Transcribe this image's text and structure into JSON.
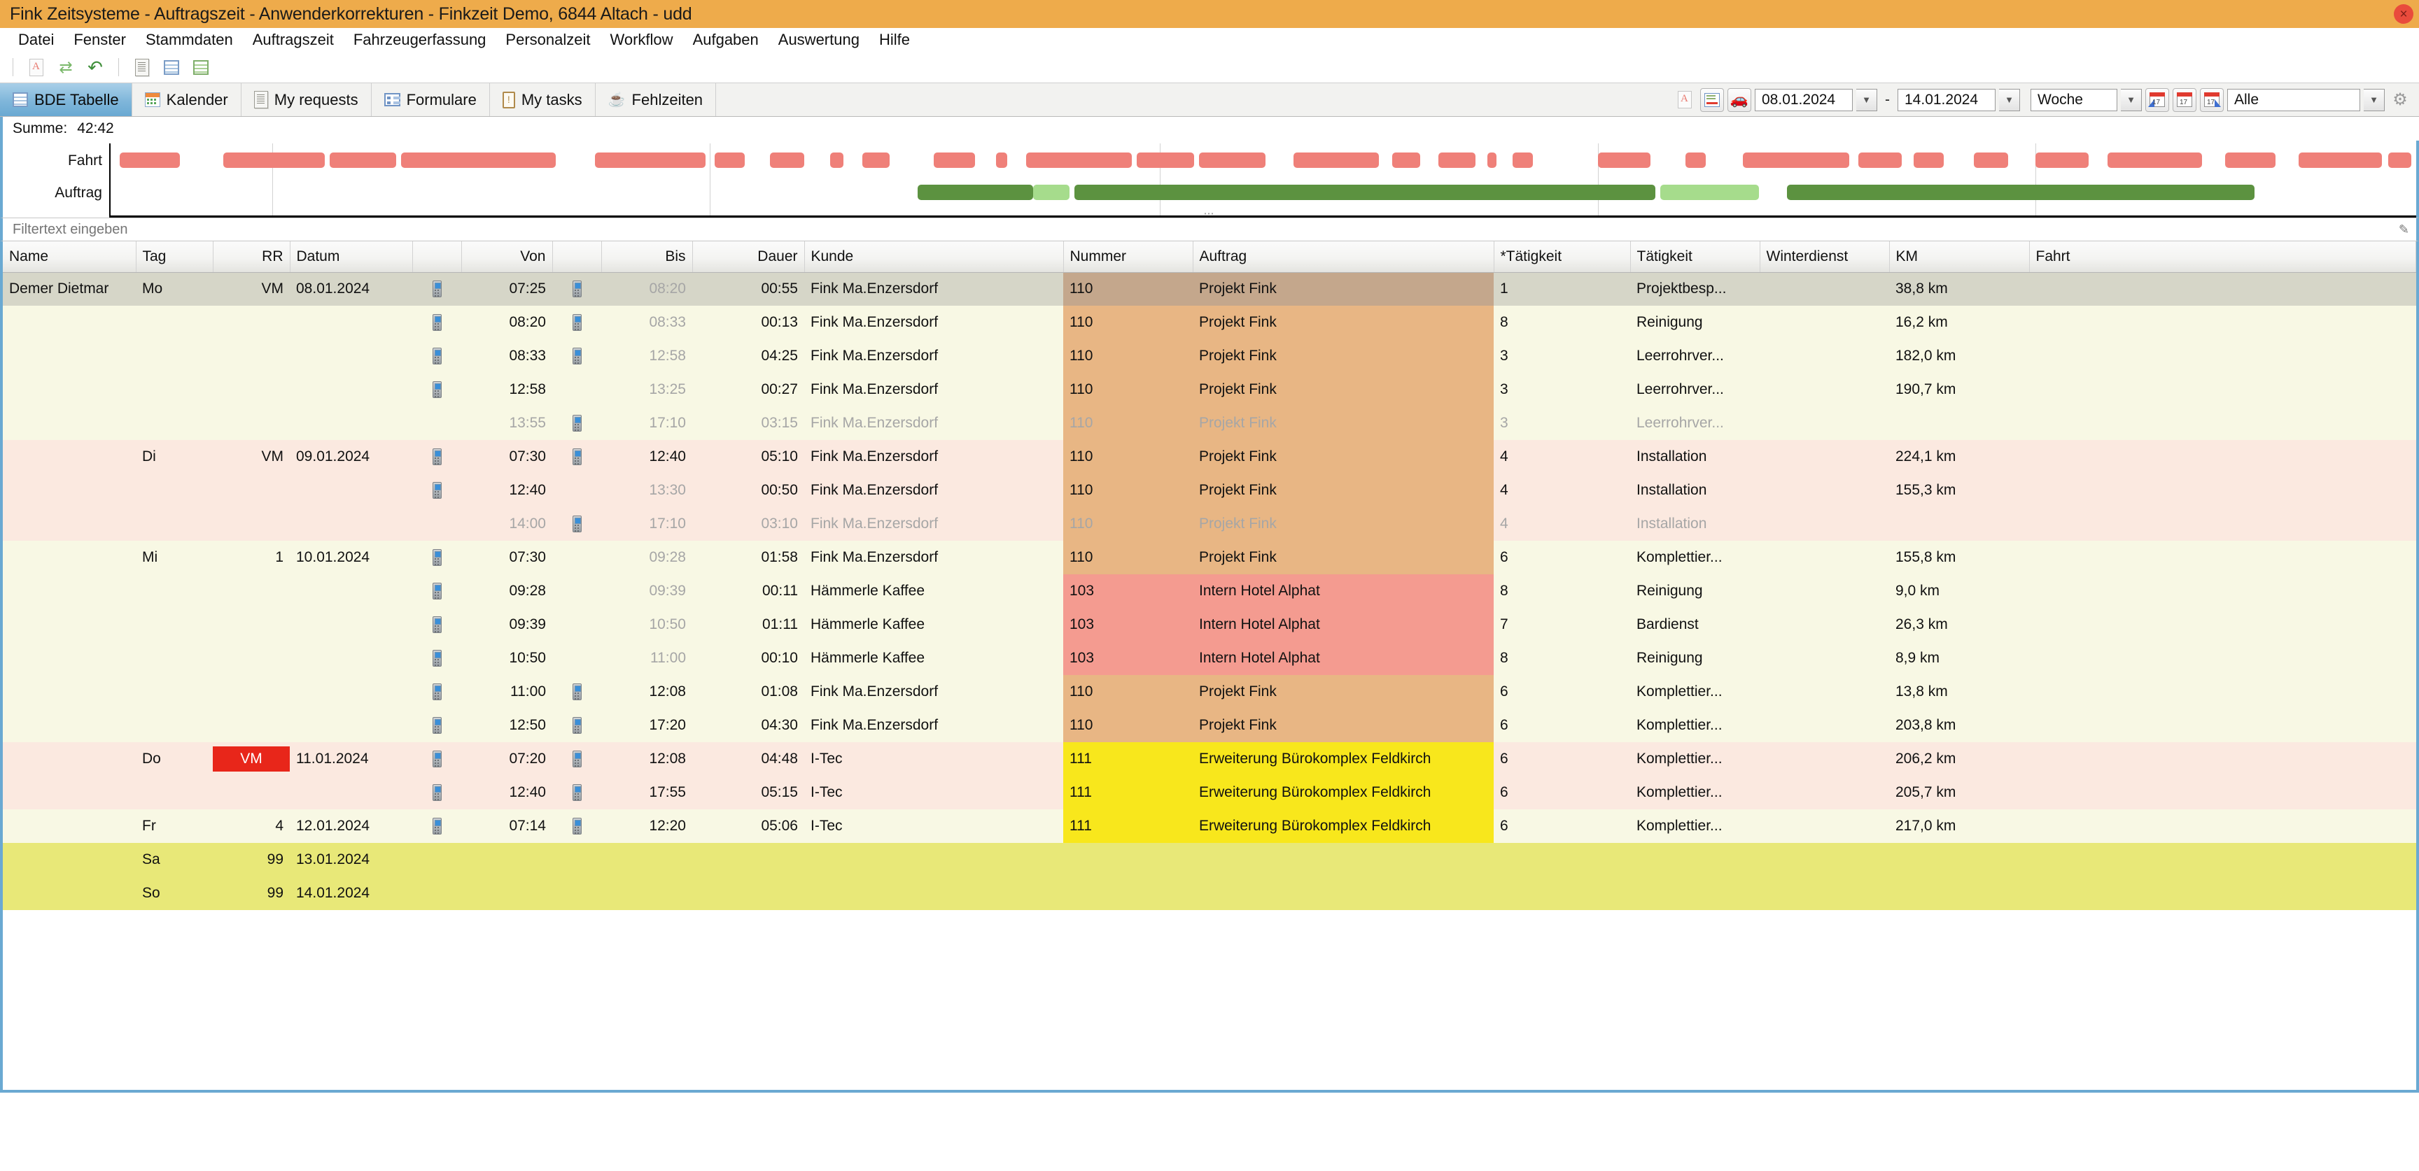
{
  "window": {
    "title": "Fink Zeitsysteme - Auftragszeit - Anwenderkorrekturen - Finkzeit Demo, 6844 Altach - udd",
    "close_label": "×",
    "titlebar_color": "#eeab4b"
  },
  "menubar": {
    "items": [
      "Datei",
      "Fenster",
      "Stammdaten",
      "Auftragszeit",
      "Fahrzeugerfassung",
      "Personalzeit",
      "Workflow",
      "Aufgaben",
      "Auswertung",
      "Hilfe"
    ]
  },
  "toolbar": {
    "icons": [
      "pdf-icon",
      "refresh-icon",
      "undo-icon",
      "document-icon",
      "table-icon",
      "table-green-icon"
    ]
  },
  "tabs": [
    {
      "label": "BDE Tabelle",
      "icon": "table-icon",
      "active": true
    },
    {
      "label": "Kalender",
      "icon": "calendar-icon",
      "active": false
    },
    {
      "label": "My requests",
      "icon": "document-icon",
      "active": false
    },
    {
      "label": "Formulare",
      "icon": "form-icon",
      "active": false
    },
    {
      "label": "My tasks",
      "icon": "clipboard-icon",
      "active": false
    },
    {
      "label": "Fehlzeiten",
      "icon": "coffee-icon",
      "active": false
    }
  ],
  "toolbar_right": {
    "pdf_icon": "pdf-icon",
    "export_icon": "export-table-icon",
    "vehicle_icon": "vehicle-icon",
    "date_from": "08.01.2024",
    "date_to": "14.01.2024",
    "date_separator": "-",
    "dropdown_arrow": "▼",
    "range_mode": "Woche",
    "calendar_prev_icon": "calendar-prev-icon",
    "calendar_today_icon": "calendar-today-icon",
    "calendar_next_icon": "calendar-next-icon",
    "filter_scope": "Alle",
    "settings_icon": "gear-icon"
  },
  "summary": {
    "label": "Summe:",
    "value": "42:42"
  },
  "gantt": {
    "rows": [
      {
        "label": "Fahrt"
      },
      {
        "label": "Auftrag"
      }
    ],
    "gridlines_pct": [
      7.0,
      26.0,
      45.5,
      64.5,
      83.5
    ],
    "fahrt_bars": [
      {
        "left": 0.4,
        "width": 2.6
      },
      {
        "left": 4.9,
        "width": 4.4
      },
      {
        "left": 9.5,
        "width": 2.9
      },
      {
        "left": 12.6,
        "width": 6.7
      },
      {
        "left": 21.0,
        "width": 4.8
      },
      {
        "left": 26.2,
        "width": 1.3
      },
      {
        "left": 28.6,
        "width": 1.5
      },
      {
        "left": 31.2,
        "width": 0.6
      },
      {
        "left": 32.6,
        "width": 1.2
      },
      {
        "left": 35.7,
        "width": 1.8
      },
      {
        "left": 38.4,
        "width": 0.5
      },
      {
        "left": 39.7,
        "width": 4.6
      },
      {
        "left": 44.5,
        "width": 2.5
      },
      {
        "left": 47.2,
        "width": 2.9
      },
      {
        "left": 51.3,
        "width": 3.7
      },
      {
        "left": 55.6,
        "width": 1.2
      },
      {
        "left": 57.6,
        "width": 1.6
      },
      {
        "left": 59.7,
        "width": 0.4
      },
      {
        "left": 60.8,
        "width": 0.9
      },
      {
        "left": 64.5,
        "width": 2.3
      },
      {
        "left": 68.3,
        "width": 0.9
      },
      {
        "left": 70.8,
        "width": 4.6
      },
      {
        "left": 75.8,
        "width": 1.9
      },
      {
        "left": 78.2,
        "width": 1.3
      },
      {
        "left": 80.8,
        "width": 1.5
      },
      {
        "left": 83.5,
        "width": 2.3
      },
      {
        "left": 86.6,
        "width": 4.1
      },
      {
        "left": 91.7,
        "width": 2.2
      },
      {
        "left": 94.9,
        "width": 3.6
      },
      {
        "left": 98.8,
        "width": 1.0
      }
    ],
    "auftrag_bars": [
      {
        "left": 35.0,
        "width": 5.0,
        "shade": "dark"
      },
      {
        "left": 40.0,
        "width": 1.6,
        "shade": "light"
      },
      {
        "left": 41.8,
        "width": 25.2,
        "shade": "dark"
      },
      {
        "left": 67.2,
        "width": 4.3,
        "shade": "light"
      },
      {
        "left": 72.7,
        "width": 20.3,
        "shade": "dark"
      }
    ],
    "resize_handle": "⋯"
  },
  "filter": {
    "placeholder": "Filtertext eingeben",
    "value": "",
    "icon": "filter-pencil-icon"
  },
  "table": {
    "columns": [
      {
        "label": "Name",
        "align": "left"
      },
      {
        "label": "Tag",
        "align": "left"
      },
      {
        "label": "RR",
        "align": "right"
      },
      {
        "label": "Datum",
        "align": "left"
      },
      {
        "label": "",
        "align": "left"
      },
      {
        "label": "Von",
        "align": "right"
      },
      {
        "label": "",
        "align": "left"
      },
      {
        "label": "Bis",
        "align": "right"
      },
      {
        "label": "Dauer",
        "align": "right"
      },
      {
        "label": "Kunde",
        "align": "left"
      },
      {
        "label": "Nummer",
        "align": "left"
      },
      {
        "label": "Auftrag",
        "align": "left"
      },
      {
        "label": "*Tätigkeit",
        "align": "left"
      },
      {
        "label": "Tätigkeit",
        "align": "left"
      },
      {
        "label": "Winterdienst",
        "align": "left"
      },
      {
        "label": "KM",
        "align": "left"
      },
      {
        "label": "Fahrt",
        "align": "left"
      }
    ],
    "rows": [
      {
        "name": "Demer Dietmar",
        "tag": "Mo",
        "rr": "VM",
        "rr_badge": false,
        "datum": "08.01.2024",
        "von_icon": true,
        "von": "07:25",
        "von_dim": false,
        "bis_icon": true,
        "bis": "08:20",
        "bis_dim": true,
        "dauer": "00:55",
        "kunde": "Fink Ma.Enzersdorf",
        "nummer": "110",
        "auftrag": "Projekt Fink",
        "taet_nr": "1",
        "taetigkeit": "Projektbesp...",
        "winterdienst": "",
        "km": "38,8 km",
        "fahrt": "",
        "row_bg": "#d6d6c8",
        "order_bg": "#c4a78c",
        "dim": false
      },
      {
        "name": "",
        "tag": "",
        "rr": "",
        "rr_badge": false,
        "datum": "",
        "von_icon": true,
        "von": "08:20",
        "von_dim": false,
        "bis_icon": true,
        "bis": "08:33",
        "bis_dim": true,
        "dauer": "00:13",
        "kunde": "Fink Ma.Enzersdorf",
        "nummer": "110",
        "auftrag": "Projekt Fink",
        "taet_nr": "8",
        "taetigkeit": "Reinigung",
        "winterdienst": "",
        "km": "16,2 km",
        "fahrt": "",
        "row_bg": "#f8f8e4",
        "order_bg": "#e8b684",
        "dim": false
      },
      {
        "name": "",
        "tag": "",
        "rr": "",
        "rr_badge": false,
        "datum": "",
        "von_icon": true,
        "von": "08:33",
        "von_dim": false,
        "bis_icon": true,
        "bis": "12:58",
        "bis_dim": true,
        "dauer": "04:25",
        "kunde": "Fink Ma.Enzersdorf",
        "nummer": "110",
        "auftrag": "Projekt Fink",
        "taet_nr": "3",
        "taetigkeit": "Leerrohrver...",
        "winterdienst": "",
        "km": "182,0 km",
        "fahrt": "",
        "row_bg": "#f8f8e4",
        "order_bg": "#e8b684",
        "dim": false
      },
      {
        "name": "",
        "tag": "",
        "rr": "",
        "rr_badge": false,
        "datum": "",
        "von_icon": true,
        "von": "12:58",
        "von_dim": false,
        "bis_icon": false,
        "bis": "13:25",
        "bis_dim": true,
        "dauer": "00:27",
        "kunde": "Fink Ma.Enzersdorf",
        "nummer": "110",
        "auftrag": "Projekt Fink",
        "taet_nr": "3",
        "taetigkeit": "Leerrohrver...",
        "winterdienst": "",
        "km": "190,7 km",
        "fahrt": "",
        "row_bg": "#f8f8e4",
        "order_bg": "#e8b684",
        "dim": false
      },
      {
        "name": "",
        "tag": "",
        "rr": "",
        "rr_badge": false,
        "datum": "",
        "von_icon": false,
        "von": "13:55",
        "von_dim": true,
        "bis_icon": true,
        "bis": "17:10",
        "bis_dim": false,
        "dauer": "03:15",
        "kunde": "Fink Ma.Enzersdorf",
        "nummer": "110",
        "auftrag": "Projekt Fink",
        "taet_nr": "3",
        "taetigkeit": "Leerrohrver...",
        "winterdienst": "",
        "km": "",
        "fahrt": "",
        "row_bg": "#f8f8e4",
        "order_bg": "#e8b684",
        "dim": true
      },
      {
        "name": "",
        "tag": "Di",
        "rr": "VM",
        "rr_badge": false,
        "datum": "09.01.2024",
        "von_icon": true,
        "von": "07:30",
        "von_dim": false,
        "bis_icon": true,
        "bis": "12:40",
        "bis_dim": false,
        "dauer": "05:10",
        "kunde": "Fink Ma.Enzersdorf",
        "nummer": "110",
        "auftrag": "Projekt Fink",
        "taet_nr": "4",
        "taetigkeit": "Installation",
        "winterdienst": "",
        "km": "224,1 km",
        "fahrt": "",
        "row_bg": "#fbe9e0",
        "order_bg": "#e8b684",
        "dim": false
      },
      {
        "name": "",
        "tag": "",
        "rr": "",
        "rr_badge": false,
        "datum": "",
        "von_icon": true,
        "von": "12:40",
        "von_dim": false,
        "bis_icon": false,
        "bis": "13:30",
        "bis_dim": true,
        "dauer": "00:50",
        "kunde": "Fink Ma.Enzersdorf",
        "nummer": "110",
        "auftrag": "Projekt Fink",
        "taet_nr": "4",
        "taetigkeit": "Installation",
        "winterdienst": "",
        "km": "155,3 km",
        "fahrt": "",
        "row_bg": "#fbe9e0",
        "order_bg": "#e8b684",
        "dim": false
      },
      {
        "name": "",
        "tag": "",
        "rr": "",
        "rr_badge": false,
        "datum": "",
        "von_icon": false,
        "von": "14:00",
        "von_dim": true,
        "bis_icon": true,
        "bis": "17:10",
        "bis_dim": false,
        "dauer": "03:10",
        "kunde": "Fink Ma.Enzersdorf",
        "nummer": "110",
        "auftrag": "Projekt Fink",
        "taet_nr": "4",
        "taetigkeit": "Installation",
        "winterdienst": "",
        "km": "",
        "fahrt": "",
        "row_bg": "#fbe9e0",
        "order_bg": "#e8b684",
        "dim": true
      },
      {
        "name": "",
        "tag": "Mi",
        "rr": "1",
        "rr_badge": false,
        "datum": "10.01.2024",
        "von_icon": true,
        "von": "07:30",
        "von_dim": false,
        "bis_icon": false,
        "bis": "09:28",
        "bis_dim": true,
        "dauer": "01:58",
        "kunde": "Fink Ma.Enzersdorf",
        "nummer": "110",
        "auftrag": "Projekt Fink",
        "taet_nr": "6",
        "taetigkeit": "Komplettier...",
        "winterdienst": "",
        "km": "155,8 km",
        "fahrt": "",
        "row_bg": "#f8f8e4",
        "order_bg": "#e8b684",
        "dim": false
      },
      {
        "name": "",
        "tag": "",
        "rr": "",
        "rr_badge": false,
        "datum": "",
        "von_icon": true,
        "von": "09:28",
        "von_dim": false,
        "bis_icon": false,
        "bis": "09:39",
        "bis_dim": true,
        "dauer": "00:11",
        "kunde": "Hämmerle Kaffee",
        "nummer": "103",
        "auftrag": "Intern Hotel Alphat",
        "taet_nr": "8",
        "taetigkeit": "Reinigung",
        "winterdienst": "",
        "km": "9,0 km",
        "fahrt": "",
        "row_bg": "#f8f8e4",
        "order_bg": "#f49b90",
        "dim": false
      },
      {
        "name": "",
        "tag": "",
        "rr": "",
        "rr_badge": false,
        "datum": "",
        "von_icon": true,
        "von": "09:39",
        "von_dim": false,
        "bis_icon": false,
        "bis": "10:50",
        "bis_dim": true,
        "dauer": "01:11",
        "kunde": "Hämmerle Kaffee",
        "nummer": "103",
        "auftrag": "Intern Hotel Alphat",
        "taet_nr": "7",
        "taetigkeit": "Bardienst",
        "winterdienst": "",
        "km": "26,3 km",
        "fahrt": "",
        "row_bg": "#f8f8e4",
        "order_bg": "#f49b90",
        "dim": false
      },
      {
        "name": "",
        "tag": "",
        "rr": "",
        "rr_badge": false,
        "datum": "",
        "von_icon": true,
        "von": "10:50",
        "von_dim": false,
        "bis_icon": false,
        "bis": "11:00",
        "bis_dim": true,
        "dauer": "00:10",
        "kunde": "Hämmerle Kaffee",
        "nummer": "103",
        "auftrag": "Intern Hotel Alphat",
        "taet_nr": "8",
        "taetigkeit": "Reinigung",
        "winterdienst": "",
        "km": "8,9 km",
        "fahrt": "",
        "row_bg": "#f8f8e4",
        "order_bg": "#f49b90",
        "dim": false
      },
      {
        "name": "",
        "tag": "",
        "rr": "",
        "rr_badge": false,
        "datum": "",
        "von_icon": true,
        "von": "11:00",
        "von_dim": false,
        "bis_icon": true,
        "bis": "12:08",
        "bis_dim": false,
        "dauer": "01:08",
        "kunde": "Fink Ma.Enzersdorf",
        "nummer": "110",
        "auftrag": "Projekt Fink",
        "taet_nr": "6",
        "taetigkeit": "Komplettier...",
        "winterdienst": "",
        "km": "13,8 km",
        "fahrt": "",
        "row_bg": "#f8f8e4",
        "order_bg": "#e8b684",
        "dim": false
      },
      {
        "name": "",
        "tag": "",
        "rr": "",
        "rr_badge": false,
        "datum": "",
        "von_icon": true,
        "von": "12:50",
        "von_dim": false,
        "bis_icon": true,
        "bis": "17:20",
        "bis_dim": false,
        "dauer": "04:30",
        "kunde": "Fink Ma.Enzersdorf",
        "nummer": "110",
        "auftrag": "Projekt Fink",
        "taet_nr": "6",
        "taetigkeit": "Komplettier...",
        "winterdienst": "",
        "km": "203,8 km",
        "fahrt": "",
        "row_bg": "#f8f8e4",
        "order_bg": "#e8b684",
        "dim": false
      },
      {
        "name": "",
        "tag": "Do",
        "rr": "VM",
        "rr_badge": true,
        "datum": "11.01.2024",
        "von_icon": true,
        "von": "07:20",
        "von_dim": false,
        "bis_icon": true,
        "bis": "12:08",
        "bis_dim": false,
        "dauer": "04:48",
        "kunde": "I-Tec",
        "nummer": "111",
        "auftrag": "Erweiterung Bürokomplex Feldkirch",
        "taet_nr": "6",
        "taetigkeit": "Komplettier...",
        "winterdienst": "",
        "km": "206,2 km",
        "fahrt": "",
        "row_bg": "#fbe9e0",
        "order_bg": "#f8e71c",
        "dim": false
      },
      {
        "name": "",
        "tag": "",
        "rr": "",
        "rr_badge": false,
        "datum": "",
        "von_icon": true,
        "von": "12:40",
        "von_dim": false,
        "bis_icon": true,
        "bis": "17:55",
        "bis_dim": false,
        "dauer": "05:15",
        "kunde": "I-Tec",
        "nummer": "111",
        "auftrag": "Erweiterung Bürokomplex Feldkirch",
        "taet_nr": "6",
        "taetigkeit": "Komplettier...",
        "winterdienst": "",
        "km": "205,7 km",
        "fahrt": "",
        "row_bg": "#fbe9e0",
        "order_bg": "#f8e71c",
        "dim": false
      },
      {
        "name": "",
        "tag": "Fr",
        "rr": "4",
        "rr_badge": false,
        "datum": "12.01.2024",
        "von_icon": true,
        "von": "07:14",
        "von_dim": false,
        "bis_icon": true,
        "bis": "12:20",
        "bis_dim": false,
        "dauer": "05:06",
        "kunde": "I-Tec",
        "nummer": "111",
        "auftrag": "Erweiterung Bürokomplex Feldkirch",
        "taet_nr": "6",
        "taetigkeit": "Komplettier...",
        "winterdienst": "",
        "km": "217,0 km",
        "fahrt": "",
        "row_bg": "#f8f8e4",
        "order_bg": "#f8e71c",
        "dim": false
      },
      {
        "name": "",
        "tag": "Sa",
        "rr": "99",
        "rr_badge": false,
        "datum": "13.01.2024",
        "von_icon": false,
        "von": "",
        "von_dim": false,
        "bis_icon": false,
        "bis": "",
        "bis_dim": false,
        "dauer": "",
        "kunde": "",
        "nummer": "",
        "auftrag": "",
        "taet_nr": "",
        "taetigkeit": "",
        "winterdienst": "",
        "km": "",
        "fahrt": "",
        "row_bg": "#e8e878",
        "order_bg": "#e8e878",
        "dim": false
      },
      {
        "name": "",
        "tag": "So",
        "rr": "99",
        "rr_badge": false,
        "datum": "14.01.2024",
        "von_icon": false,
        "von": "",
        "von_dim": false,
        "bis_icon": false,
        "bis": "",
        "bis_dim": false,
        "dauer": "",
        "kunde": "",
        "nummer": "",
        "auftrag": "",
        "taet_nr": "",
        "taetigkeit": "",
        "winterdienst": "",
        "km": "",
        "fahrt": "",
        "row_bg": "#e8e878",
        "order_bg": "#e8e878",
        "dim": false
      }
    ]
  }
}
